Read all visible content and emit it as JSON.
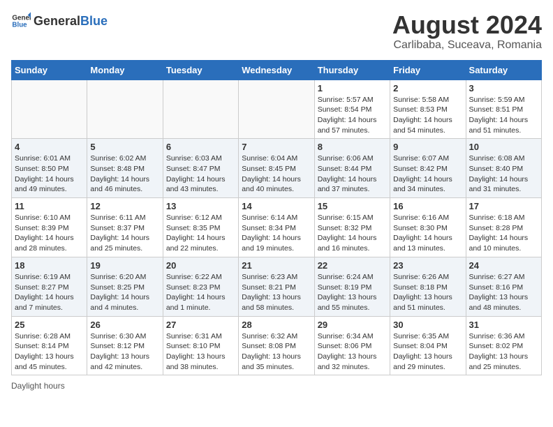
{
  "header": {
    "logo_general": "General",
    "logo_blue": "Blue",
    "month_title": "August 2024",
    "location": "Carlibaba, Suceava, Romania"
  },
  "weekdays": [
    "Sunday",
    "Monday",
    "Tuesday",
    "Wednesday",
    "Thursday",
    "Friday",
    "Saturday"
  ],
  "footer_note": "Daylight hours",
  "weeks": [
    [
      {
        "day": "",
        "info": ""
      },
      {
        "day": "",
        "info": ""
      },
      {
        "day": "",
        "info": ""
      },
      {
        "day": "",
        "info": ""
      },
      {
        "day": "1",
        "info": "Sunrise: 5:57 AM\nSunset: 8:54 PM\nDaylight: 14 hours and 57 minutes."
      },
      {
        "day": "2",
        "info": "Sunrise: 5:58 AM\nSunset: 8:53 PM\nDaylight: 14 hours and 54 minutes."
      },
      {
        "day": "3",
        "info": "Sunrise: 5:59 AM\nSunset: 8:51 PM\nDaylight: 14 hours and 51 minutes."
      }
    ],
    [
      {
        "day": "4",
        "info": "Sunrise: 6:01 AM\nSunset: 8:50 PM\nDaylight: 14 hours and 49 minutes."
      },
      {
        "day": "5",
        "info": "Sunrise: 6:02 AM\nSunset: 8:48 PM\nDaylight: 14 hours and 46 minutes."
      },
      {
        "day": "6",
        "info": "Sunrise: 6:03 AM\nSunset: 8:47 PM\nDaylight: 14 hours and 43 minutes."
      },
      {
        "day": "7",
        "info": "Sunrise: 6:04 AM\nSunset: 8:45 PM\nDaylight: 14 hours and 40 minutes."
      },
      {
        "day": "8",
        "info": "Sunrise: 6:06 AM\nSunset: 8:44 PM\nDaylight: 14 hours and 37 minutes."
      },
      {
        "day": "9",
        "info": "Sunrise: 6:07 AM\nSunset: 8:42 PM\nDaylight: 14 hours and 34 minutes."
      },
      {
        "day": "10",
        "info": "Sunrise: 6:08 AM\nSunset: 8:40 PM\nDaylight: 14 hours and 31 minutes."
      }
    ],
    [
      {
        "day": "11",
        "info": "Sunrise: 6:10 AM\nSunset: 8:39 PM\nDaylight: 14 hours and 28 minutes."
      },
      {
        "day": "12",
        "info": "Sunrise: 6:11 AM\nSunset: 8:37 PM\nDaylight: 14 hours and 25 minutes."
      },
      {
        "day": "13",
        "info": "Sunrise: 6:12 AM\nSunset: 8:35 PM\nDaylight: 14 hours and 22 minutes."
      },
      {
        "day": "14",
        "info": "Sunrise: 6:14 AM\nSunset: 8:34 PM\nDaylight: 14 hours and 19 minutes."
      },
      {
        "day": "15",
        "info": "Sunrise: 6:15 AM\nSunset: 8:32 PM\nDaylight: 14 hours and 16 minutes."
      },
      {
        "day": "16",
        "info": "Sunrise: 6:16 AM\nSunset: 8:30 PM\nDaylight: 14 hours and 13 minutes."
      },
      {
        "day": "17",
        "info": "Sunrise: 6:18 AM\nSunset: 8:28 PM\nDaylight: 14 hours and 10 minutes."
      }
    ],
    [
      {
        "day": "18",
        "info": "Sunrise: 6:19 AM\nSunset: 8:27 PM\nDaylight: 14 hours and 7 minutes."
      },
      {
        "day": "19",
        "info": "Sunrise: 6:20 AM\nSunset: 8:25 PM\nDaylight: 14 hours and 4 minutes."
      },
      {
        "day": "20",
        "info": "Sunrise: 6:22 AM\nSunset: 8:23 PM\nDaylight: 14 hours and 1 minute."
      },
      {
        "day": "21",
        "info": "Sunrise: 6:23 AM\nSunset: 8:21 PM\nDaylight: 13 hours and 58 minutes."
      },
      {
        "day": "22",
        "info": "Sunrise: 6:24 AM\nSunset: 8:19 PM\nDaylight: 13 hours and 55 minutes."
      },
      {
        "day": "23",
        "info": "Sunrise: 6:26 AM\nSunset: 8:18 PM\nDaylight: 13 hours and 51 minutes."
      },
      {
        "day": "24",
        "info": "Sunrise: 6:27 AM\nSunset: 8:16 PM\nDaylight: 13 hours and 48 minutes."
      }
    ],
    [
      {
        "day": "25",
        "info": "Sunrise: 6:28 AM\nSunset: 8:14 PM\nDaylight: 13 hours and 45 minutes."
      },
      {
        "day": "26",
        "info": "Sunrise: 6:30 AM\nSunset: 8:12 PM\nDaylight: 13 hours and 42 minutes."
      },
      {
        "day": "27",
        "info": "Sunrise: 6:31 AM\nSunset: 8:10 PM\nDaylight: 13 hours and 38 minutes."
      },
      {
        "day": "28",
        "info": "Sunrise: 6:32 AM\nSunset: 8:08 PM\nDaylight: 13 hours and 35 minutes."
      },
      {
        "day": "29",
        "info": "Sunrise: 6:34 AM\nSunset: 8:06 PM\nDaylight: 13 hours and 32 minutes."
      },
      {
        "day": "30",
        "info": "Sunrise: 6:35 AM\nSunset: 8:04 PM\nDaylight: 13 hours and 29 minutes."
      },
      {
        "day": "31",
        "info": "Sunrise: 6:36 AM\nSunset: 8:02 PM\nDaylight: 13 hours and 25 minutes."
      }
    ]
  ]
}
